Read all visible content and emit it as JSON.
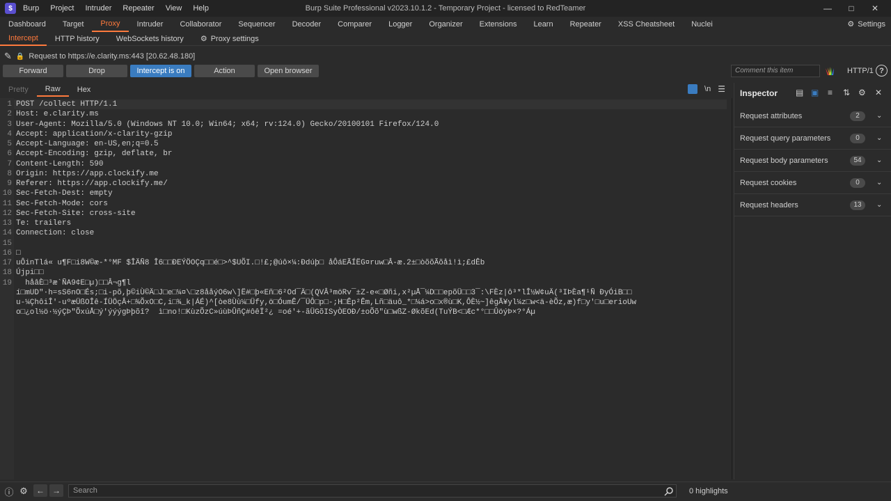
{
  "window": {
    "title": "Burp Suite Professional v2023.10.1.2 - Temporary Project - licensed to RedTeamer",
    "menu": [
      "Burp",
      "Project",
      "Intruder",
      "Repeater",
      "View",
      "Help"
    ]
  },
  "main_tabs": [
    "Dashboard",
    "Target",
    "Proxy",
    "Intruder",
    "Collaborator",
    "Sequencer",
    "Decoder",
    "Comparer",
    "Logger",
    "Organizer",
    "Extensions",
    "Learn",
    "Repeater",
    "XSS Cheatsheet",
    "Nuclei"
  ],
  "active_main_tab": "Proxy",
  "settings_label": "Settings",
  "sub_tabs": [
    "Intercept",
    "HTTP history",
    "WebSockets history"
  ],
  "proxy_settings_label": "Proxy settings",
  "request_info": "Request to https://e.clarity.ms:443  [20.62.48.180]",
  "actions": {
    "forward": "Forward",
    "drop": "Drop",
    "intercept": "Intercept is on",
    "action": "Action",
    "open_browser": "Open browser",
    "comment_placeholder": "Comment this item",
    "http_version": "HTTP/1"
  },
  "editor_tabs": [
    "Pretty",
    "Raw",
    "Hex"
  ],
  "editor_tool_newline": "\\n",
  "request_lines": [
    {
      "n": "1",
      "text": "POST /collect HTTP/1.1"
    },
    {
      "n": "2",
      "text": "Host: e.clarity.ms"
    },
    {
      "n": "3",
      "text": "User-Agent: Mozilla/5.0 (Windows NT 10.0; Win64; x64; rv:124.0) Gecko/20100101 Firefox/124.0"
    },
    {
      "n": "4",
      "text": "Accept: application/x-clarity-gzip"
    },
    {
      "n": "5",
      "text": "Accept-Language: en-US,en;q=0.5"
    },
    {
      "n": "6",
      "text": "Accept-Encoding: gzip, deflate, br"
    },
    {
      "n": "7",
      "text": "Content-Length: 590"
    },
    {
      "n": "8",
      "text": "Origin: https://app.clockify.me"
    },
    {
      "n": "9",
      "text": "Referer: https://app.clockify.me/"
    },
    {
      "n": "10",
      "text": "Sec-Fetch-Dest: empty"
    },
    {
      "n": "11",
      "text": "Sec-Fetch-Mode: cors"
    },
    {
      "n": "12",
      "text": "Sec-Fetch-Site: cross-site"
    },
    {
      "n": "13",
      "text": "Te: trailers"
    },
    {
      "n": "14",
      "text": "Connection: close"
    },
    {
      "n": "15",
      "text": ""
    },
    {
      "n": "16",
      "text": "□"
    },
    {
      "n": "17",
      "text": "uÔinTlá« u¶F□i8W©æ-*°MF $ÎÄÑ8 Î6□□ÐEÝÖOÇq□□é□>^$UÕI.□!£;@úô×¼:Ðdúþ□ åÔáEÃÍËG¤ruw□Â-æ.2±□òõõÃõåì!ì;£dÊb"
    },
    {
      "n": "18",
      "text": "Újpi□□"
    },
    {
      "n": "19",
      "text": "  håâÈ□³æ`ÑA9¢E□µ)□□Â¬g¶l"
    },
    {
      "n": "",
      "text": "í□mUD\"·h=sS6nO□És;□i-põ,þ©iÙ©Ä□J□e□¼¤\\□z8ååýO6w\\]Ë#□þ«Eñ□6²Od¯Ä□(QVÂ³möRv¯±Z-e«□Øñi,x²µÅ¯¼D□□epõÜ□□3¯:\\FÈz|ô³*lÎ½W¢uÄ(³IÞÈa¶¹Ñ ÐyÓiB□□"
    },
    {
      "n": "",
      "text": "u-¼ÇhôiÎ'-uºæÜßOÎê-ÍÜÖçÂ+□¾ÕxO□C,i□¾_k|ÁÉ)^[òe8Ùù¼□Üfy,ö□ÓumÊ/¯ÜÔ□p□-;H□Êp²Êm,Lñ□äuô_*□¼á>o□x®ù□K,ÔÈ½~]êgÃ¥yl¼z□w<ä-èÕz,æ)f□y'□u□erioUw"
    },
    {
      "n": "",
      "text": "o□¿ol½ö·½ýÇÞ\"ÕxúÅ□ý'ýýýgÞþõî?  ì□no!□KùzÕzC»úùÞÛñÇ#ôêÏ²¿ =oé'+-ãÜGõISyÒEOÐ/±oÕõ\"ù□wßZ-ØkõEd(TuÝB<□Æc*°□□ÛöýÞ×?°Áµ"
    }
  ],
  "inspector": {
    "title": "Inspector",
    "rows": [
      {
        "label": "Request attributes",
        "count": "2"
      },
      {
        "label": "Request query parameters",
        "count": "0"
      },
      {
        "label": "Request body parameters",
        "count": "54"
      },
      {
        "label": "Request cookies",
        "count": "0"
      },
      {
        "label": "Request headers",
        "count": "13"
      }
    ]
  },
  "bottom": {
    "search_placeholder": "Search",
    "highlights": "0 highlights"
  },
  "colors": {
    "accent": "#ff7a3d",
    "intercept_on": "#3a7cc0",
    "background": "#2b2b2b"
  }
}
